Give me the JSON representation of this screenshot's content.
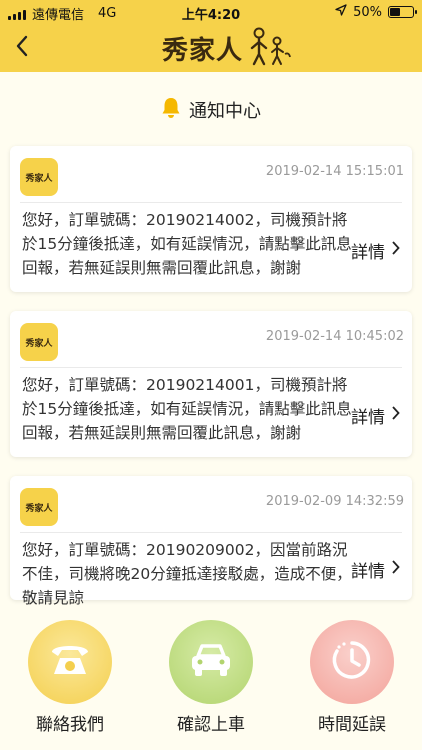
{
  "status_bar": {
    "carrier": "遠傳電信",
    "network": "4G",
    "time": "上午4:20",
    "battery_percent_text": "50%",
    "battery_level": 0.5,
    "location_icon": "location-arrow-icon"
  },
  "navbar": {
    "back_icon": "chevron-left-icon",
    "logo_text": "秀家人"
  },
  "page": {
    "title": "通知中心",
    "title_icon": "bell-icon"
  },
  "notifications": [
    {
      "avatar_text": "秀家人",
      "timestamp": "2019-02-14 15:15:01",
      "message": "您好，訂單號碼：20190214002，司機預計將於15分鐘後抵達，如有延誤情況，請點擊此訊息回報，若無延誤則無需回覆此訊息，謝謝",
      "detail_label": "詳情"
    },
    {
      "avatar_text": "秀家人",
      "timestamp": "2019-02-14 10:45:02",
      "message": "您好，訂單號碼：20190214001，司機預計將於15分鐘後抵達，如有延誤情況，請點擊此訊息回報，若無延誤則無需回覆此訊息，謝謝",
      "detail_label": "詳情"
    },
    {
      "avatar_text": "秀家人",
      "timestamp": "2019-02-09 14:32:59",
      "message": "您好，訂單號碼：20190209002，因當前路況不佳，司機將晚20分鐘抵達接駁處，造成不便，敬請見諒",
      "detail_label": "詳情"
    }
  ],
  "bottom_actions": [
    {
      "label": "聯絡我們",
      "icon": "phone-icon",
      "color": "#F7D86A"
    },
    {
      "label": "確認上車",
      "icon": "car-icon",
      "color": "#BCDB7F"
    },
    {
      "label": "時間延誤",
      "icon": "clock-icon",
      "color": "#F6B3AC"
    }
  ],
  "colors": {
    "brand_yellow": "#F6D24A",
    "background": "#FFFDF0"
  }
}
